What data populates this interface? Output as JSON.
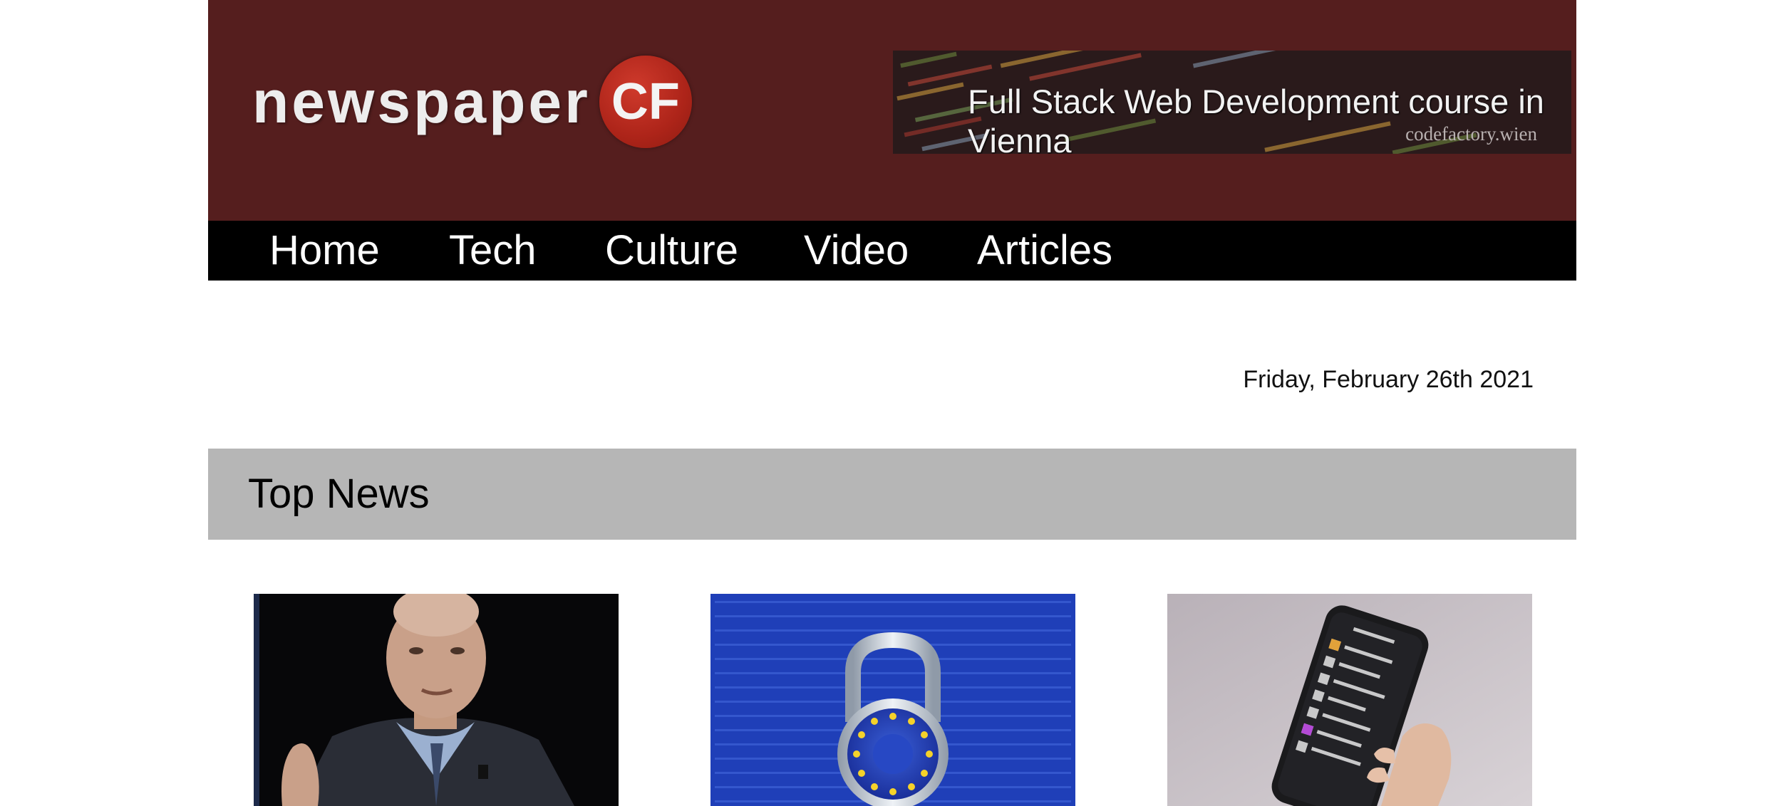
{
  "header": {
    "logo": {
      "word": "newspaper",
      "badge": "CF"
    },
    "banner": {
      "title": "Full Stack Web Development course in Vienna",
      "subtitle": "codefactory.wien"
    }
  },
  "nav": {
    "items": [
      {
        "label": "Home"
      },
      {
        "label": "Tech"
      },
      {
        "label": "Culture"
      },
      {
        "label": "Video"
      },
      {
        "label": "Articles"
      }
    ]
  },
  "date": "Friday, February 26th 2021",
  "top_news": {
    "title": "Top News",
    "cards": [
      {
        "image": "man-in-suit-photo"
      },
      {
        "image": "eu-padlock-photo"
      },
      {
        "image": "hand-holding-phone-photo"
      }
    ]
  },
  "colors": {
    "header_bg": "#551e1e",
    "nav_bg": "#000000",
    "section_bar": "#b6b6b6",
    "logo_badge": "#ad2419"
  }
}
